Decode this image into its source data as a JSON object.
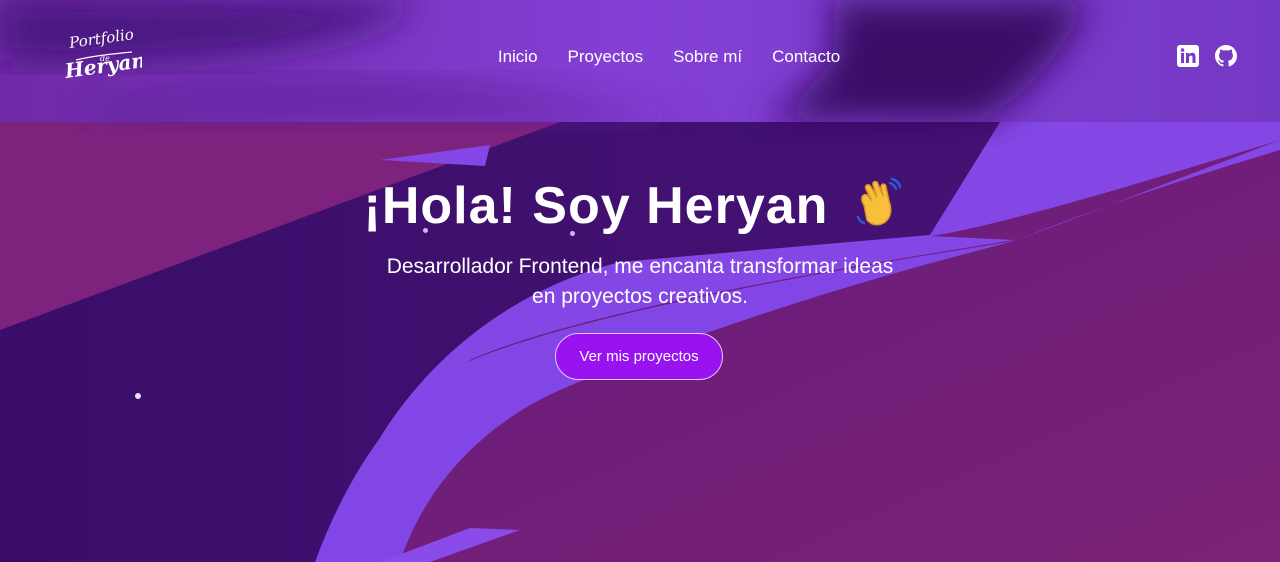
{
  "logo": {
    "line1": "Portfolio",
    "line2": "de",
    "line3": "Heryan"
  },
  "nav": {
    "items": [
      "Inicio",
      "Proyectos",
      "Sobre mí",
      "Contacto"
    ]
  },
  "social": {
    "linkedin_icon": "linkedin-icon",
    "github_icon": "github-icon"
  },
  "hero": {
    "title": "¡Hola! Soy Heryan",
    "emoji": "waving-hand-icon",
    "subtitle": "Desarrollador Frontend, me encanta transformar ideas en proyectos creativos.",
    "cta_label": "Ver mis proyectos"
  },
  "colors": {
    "primary_violet": "#8246e6",
    "deep_purple": "#3c0f6c",
    "magenta": "#7a1f74",
    "button": "#9912f0"
  }
}
